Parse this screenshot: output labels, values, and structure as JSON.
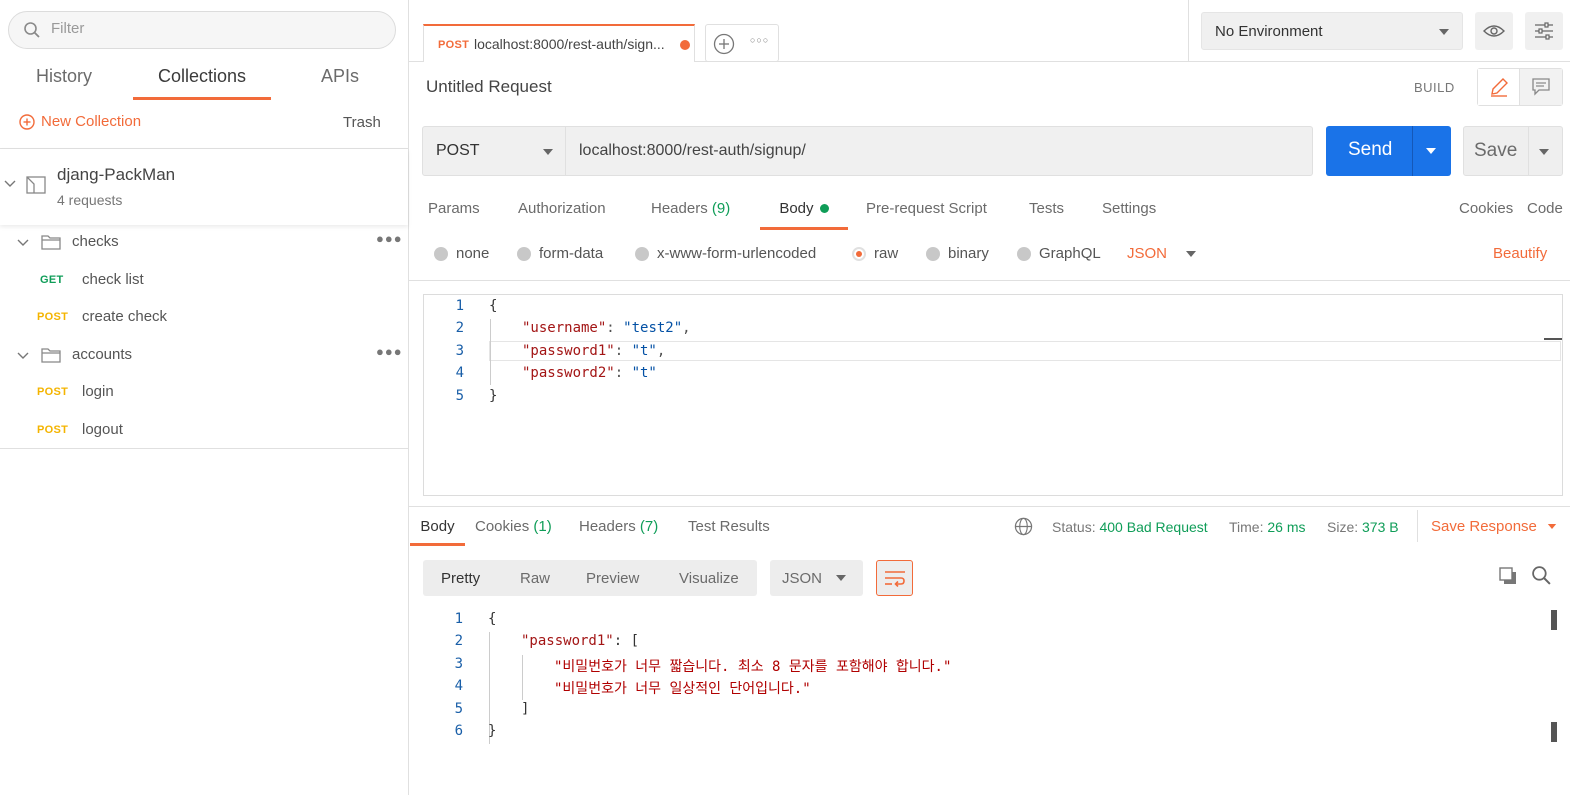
{
  "sidebar": {
    "filter_placeholder": "Filter",
    "tabs": [
      "History",
      "Collections",
      "APIs"
    ],
    "new_collection": "New Collection",
    "trash": "Trash",
    "collection": {
      "name": "djang-PackMan",
      "count": "4 requests"
    },
    "folders": [
      {
        "name": "checks",
        "requests": [
          {
            "method": "GET",
            "name": "check list"
          },
          {
            "method": "POST",
            "name": "create check"
          }
        ]
      },
      {
        "name": "accounts",
        "requests": [
          {
            "method": "POST",
            "name": "login"
          },
          {
            "method": "POST",
            "name": "logout"
          }
        ]
      }
    ]
  },
  "tabbar": {
    "tab_method": "POST",
    "tab_title": "localhost:8000/rest-auth/sign..."
  },
  "env": {
    "selected": "No Environment"
  },
  "request": {
    "title": "Untitled Request",
    "build": "BUILD",
    "method": "POST",
    "url": "localhost:8000/rest-auth/signup/",
    "send": "Send",
    "save": "Save",
    "tabs": {
      "params": "Params",
      "authorization": "Authorization",
      "headers": "Headers",
      "headers_count": "(9)",
      "body": "Body",
      "prerequest": "Pre-request Script",
      "tests": "Tests",
      "settings": "Settings"
    },
    "links": {
      "cookies": "Cookies",
      "code": "Code"
    },
    "body_types": [
      "none",
      "form-data",
      "x-www-form-urlencoded",
      "raw",
      "binary",
      "GraphQL"
    ],
    "body_format": "JSON",
    "beautify": "Beautify",
    "body_lines": {
      "l1": "{",
      "l2_key": "\"username\"",
      "l2_val": "\"test2\"",
      "l3_key": "\"password1\"",
      "l3_val": "\"t\"",
      "l4_key": "\"password2\"",
      "l4_val": "\"t\"",
      "l5": "}"
    }
  },
  "response": {
    "tabs": {
      "body": "Body",
      "cookies": "Cookies",
      "cookies_count": "(1)",
      "headers": "Headers",
      "headers_count": "(7)",
      "tests": "Test Results"
    },
    "status_label": "Status:",
    "status": "400 Bad Request",
    "time_label": "Time:",
    "time": "26 ms",
    "size_label": "Size:",
    "size": "373 B",
    "save_response": "Save Response",
    "views": [
      "Pretty",
      "Raw",
      "Preview",
      "Visualize"
    ],
    "format": "JSON",
    "body_lines": {
      "l1": "{",
      "l2_key": "\"password1\"",
      "l3": "\"비밀번호가 너무 짧습니다. 최소 8 문자를 포함해야 합니다.\"",
      "l4": "\"비밀번호가 너무 일상적인 단어입니다.\"",
      "l5": "]",
      "l6": "}"
    }
  },
  "colors": {
    "accent": "#f26b3a",
    "send": "#1a73e8",
    "ok_green": "#0f9d58",
    "post": "#f4b400"
  }
}
